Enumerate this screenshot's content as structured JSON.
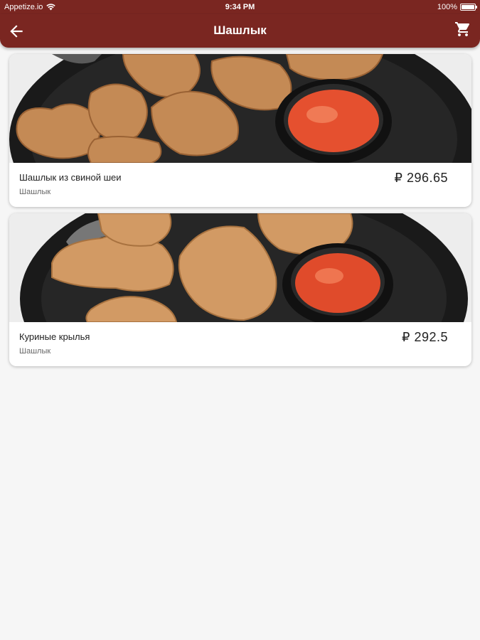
{
  "status_bar": {
    "carrier": "Appetize.io",
    "time": "9:34 PM",
    "battery": "100%",
    "battery_level": 1.0
  },
  "app_bar": {
    "title": "Шашлык",
    "icons": {
      "back": "back-arrow-icon",
      "cart": "shopping-cart-icon"
    }
  },
  "colors": {
    "brand": "#7a2621",
    "background": "#f6f6f6",
    "card": "#ffffff"
  },
  "products": [
    {
      "name": "Шашлык из свиной шеи",
      "category": "Шашлык",
      "price": "₽ 296.65"
    },
    {
      "name": "Куриные крылья",
      "category": "Шашлык",
      "price": "₽ 292.5"
    }
  ]
}
